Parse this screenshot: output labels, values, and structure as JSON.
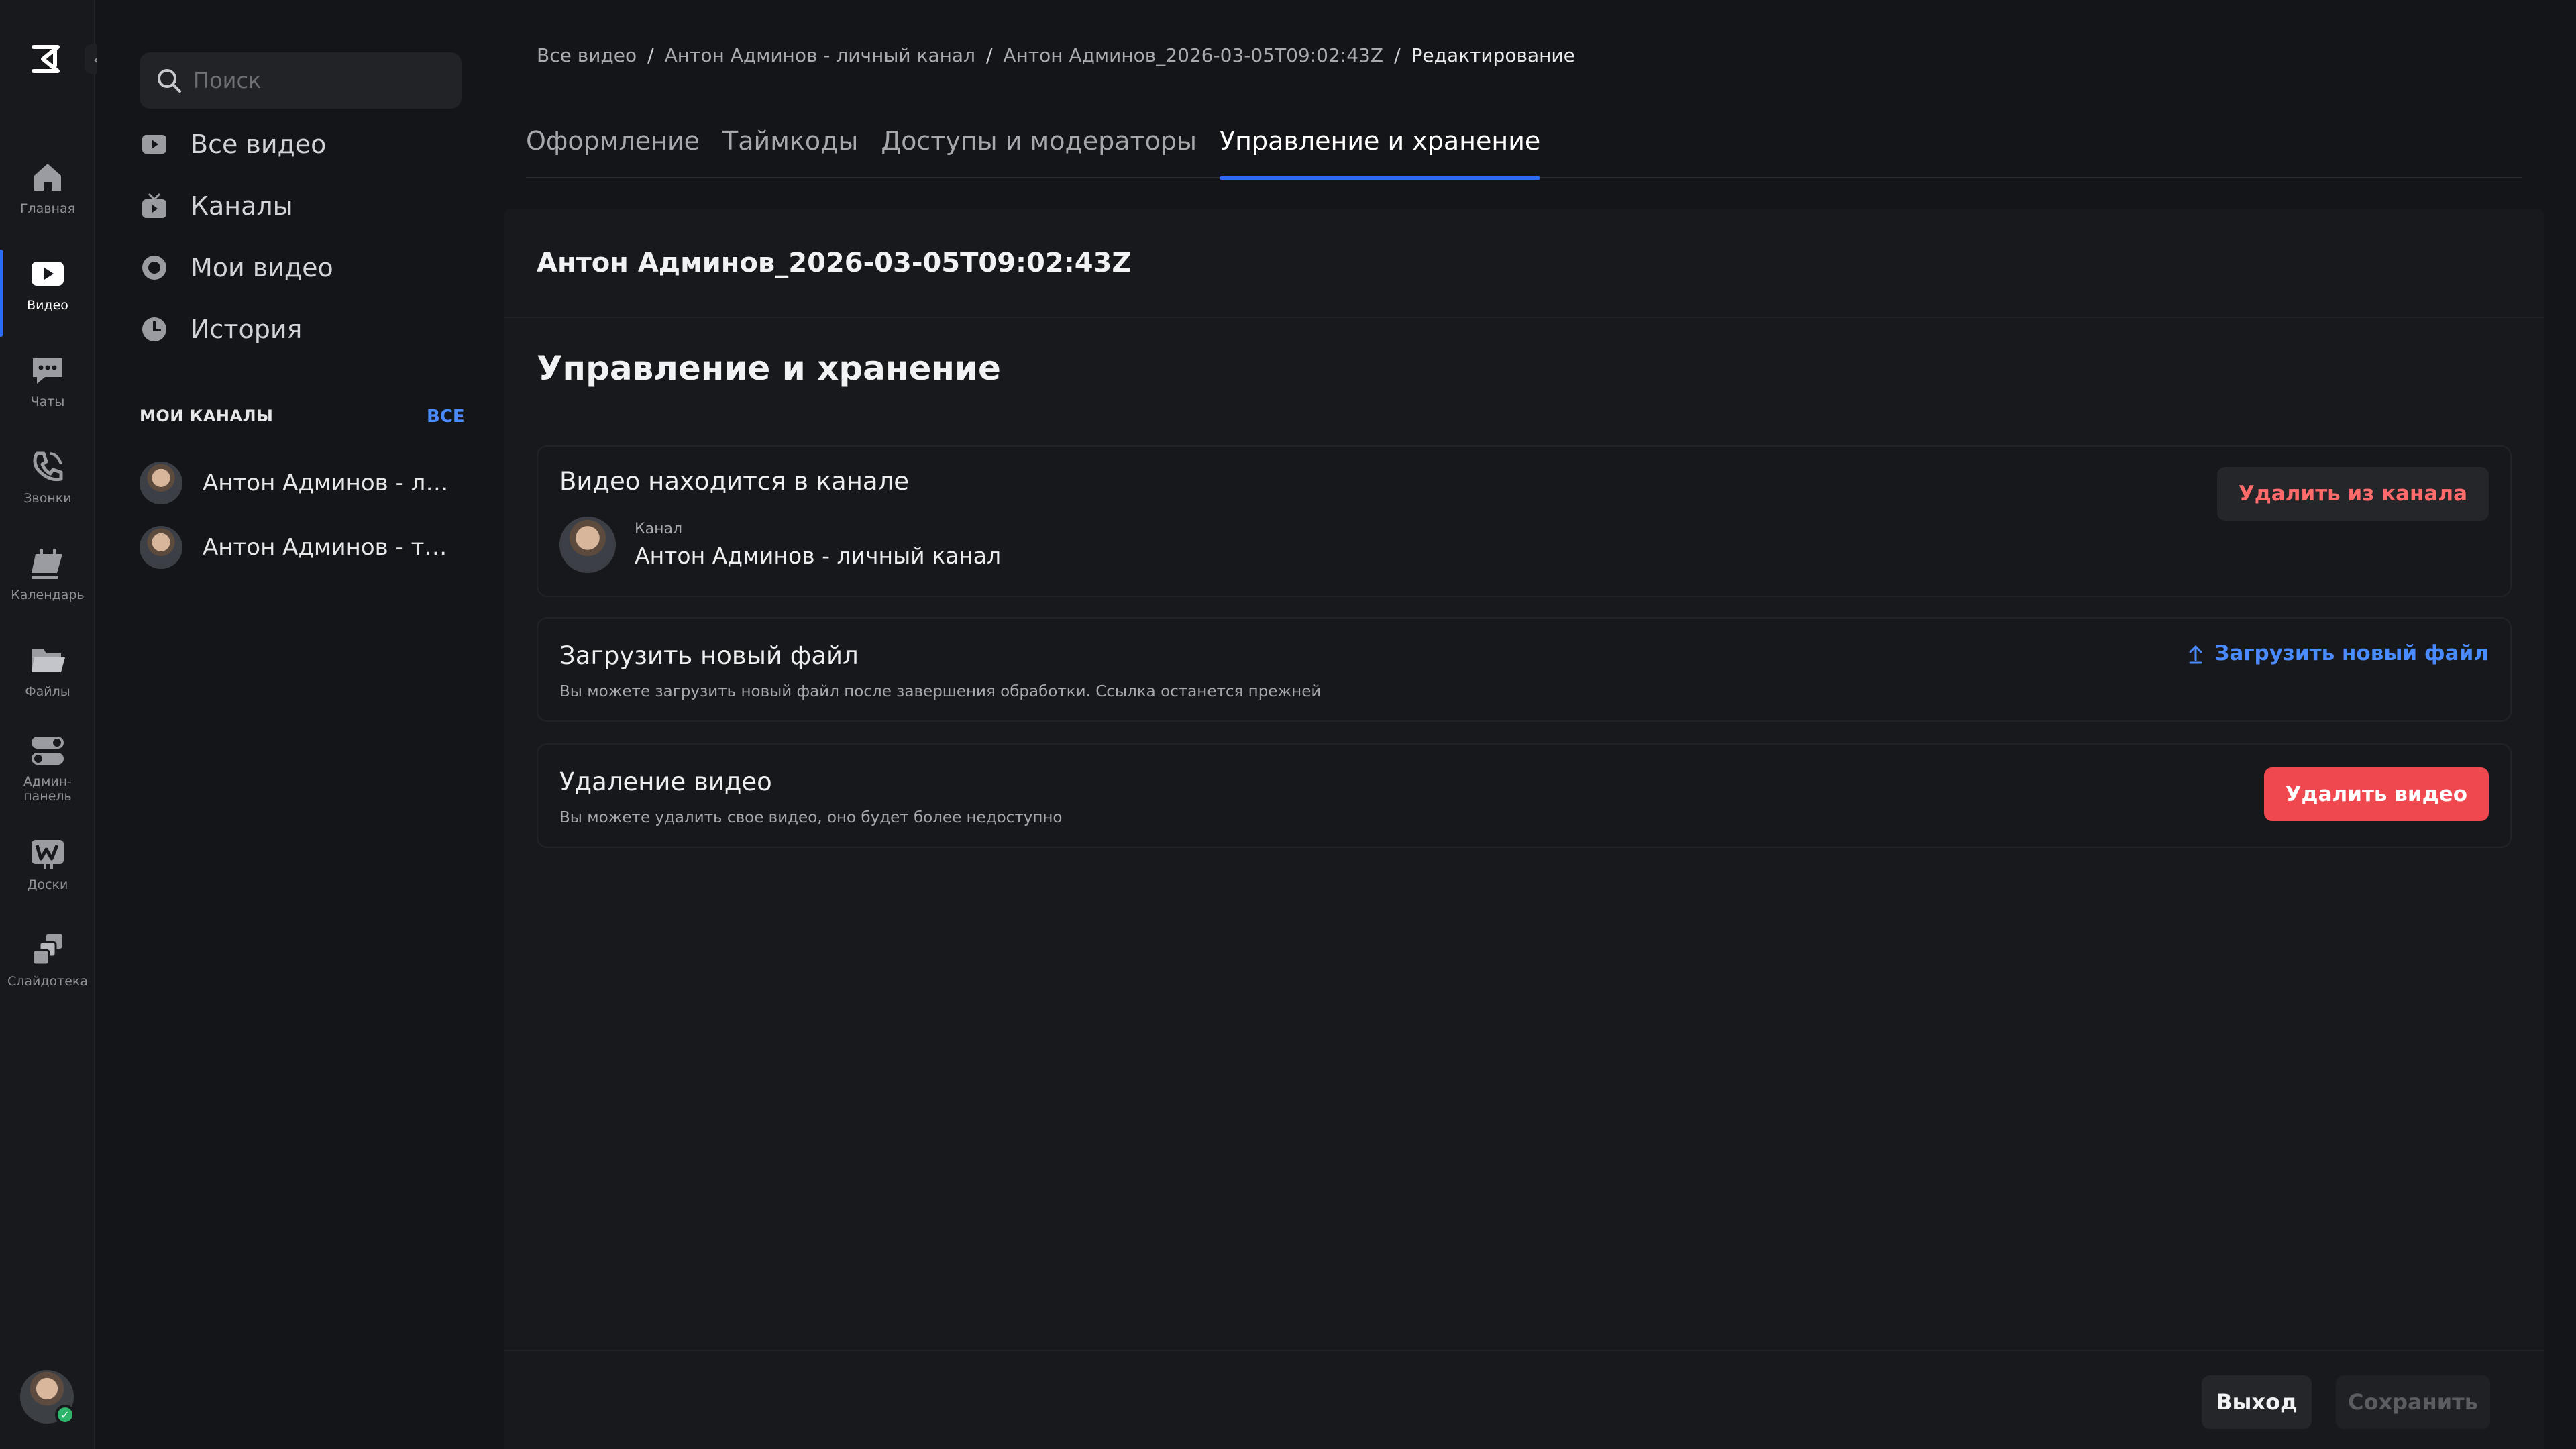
{
  "rail": {
    "items": [
      {
        "label": "Главная",
        "icon": "home-icon"
      },
      {
        "label": "Видео",
        "icon": "video-icon"
      },
      {
        "label": "Чаты",
        "icon": "chat-icon"
      },
      {
        "label": "Звонки",
        "icon": "phone-icon"
      },
      {
        "label": "Календарь",
        "icon": "calendar-icon"
      },
      {
        "label": "Файлы",
        "icon": "folder-icon"
      },
      {
        "label": "Админ-\nпанель",
        "icon": "admin-icon"
      },
      {
        "label": "Доски",
        "icon": "board-icon"
      },
      {
        "label": "Слайдотека",
        "icon": "slides-icon"
      }
    ]
  },
  "sidebar": {
    "search_placeholder": "Поиск",
    "nav": [
      {
        "label": "Все видео"
      },
      {
        "label": "Каналы"
      },
      {
        "label": "Мои видео"
      },
      {
        "label": "История"
      }
    ],
    "my_channels_title": "МОИ КАНАЛЫ",
    "all_link": "ВСЕ",
    "channels": [
      {
        "name": "Антон Админов - личный канал"
      },
      {
        "name": "Антон Админов - тестовый канал"
      }
    ]
  },
  "breadcrumb": {
    "items": [
      "Все видео",
      "Антон Админов - личный канал",
      "Антон Админов_2026-03-05T09:02:43Z"
    ],
    "current": "Редактирование",
    "separator": "/"
  },
  "tabs": [
    {
      "label": "Оформление"
    },
    {
      "label": "Таймкоды"
    },
    {
      "label": "Доступы и модераторы"
    },
    {
      "label": "Управление и хранение"
    }
  ],
  "panel": {
    "video_title": "Антон Админов_2026-03-05T09:02:43Z",
    "section_heading": "Управление и хранение",
    "channel_card": {
      "title": "Видео находится в канале",
      "caption": "Канал",
      "channel_name": "Антон Админов - личный канал",
      "remove_button": "Удалить из канала"
    },
    "upload_card": {
      "title": "Загрузить новый файл",
      "subtitle": "Вы можете загрузить новый файл после завершения обработки. Ссылка останется прежней",
      "upload_button": "Загрузить новый файл"
    },
    "delete_card": {
      "title": "Удаление видео",
      "subtitle": "Вы можете удалить свое видео, оно будет более недоступно",
      "delete_button": "Удалить видео"
    }
  },
  "footer": {
    "exit_button": "Выход",
    "save_button": "Сохранить"
  },
  "colors": {
    "accent": "#2f6bf2",
    "link": "#4a8cff",
    "danger": "#f0484f",
    "background": "#141518",
    "status_online": "#2fb56b"
  }
}
